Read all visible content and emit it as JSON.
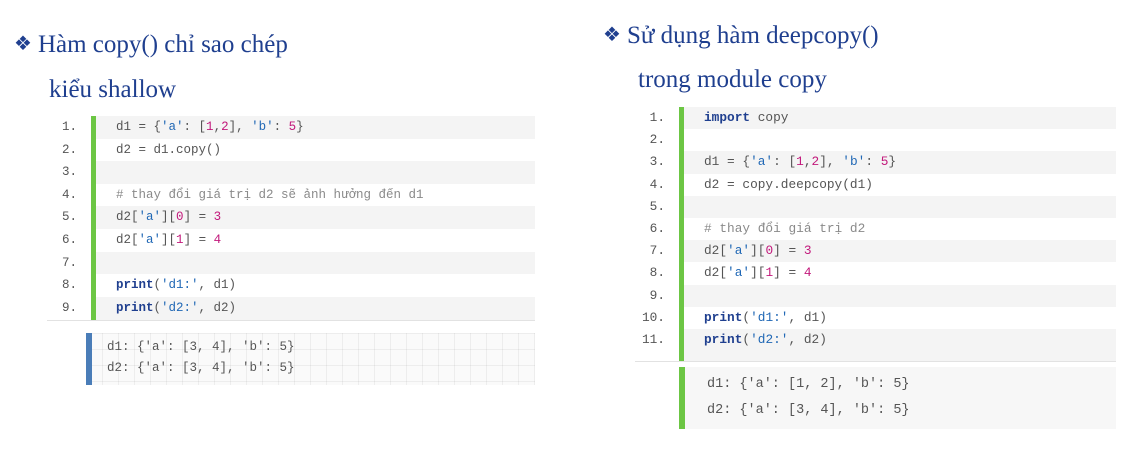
{
  "left": {
    "heading_line1": "Hàm copy() chỉ sao chép",
    "heading_line2": "kiểu shallow",
    "bullet": "❖",
    "code_lines": [
      {
        "n": "1.",
        "code": "d1 = {'a': [1,2], 'b': 5}"
      },
      {
        "n": "2.",
        "code": "d2 = d1.copy()"
      },
      {
        "n": "3.",
        "code": ""
      },
      {
        "n": "4.",
        "code": "# thay đổi giá trị d2 sẽ ảnh hưởng đến d1"
      },
      {
        "n": "5.",
        "code": "d2['a'][0] = 3"
      },
      {
        "n": "6.",
        "code": "d2['a'][1] = 4"
      },
      {
        "n": "7.",
        "code": ""
      },
      {
        "n": "8.",
        "code": "print('d1:', d1)"
      },
      {
        "n": "9.",
        "code": "print('d2:', d2)"
      }
    ],
    "output_lines": [
      "d1: {'a': [3, 4], 'b': 5}",
      "d2: {'a': [3, 4], 'b': 5}"
    ],
    "output_bar_color": "#4a7db8"
  },
  "right": {
    "heading_line1": "Sử dụng hàm deepcopy()",
    "heading_line2": "trong module copy",
    "bullet": "❖",
    "code_lines": [
      {
        "n": "1.",
        "code": "import copy"
      },
      {
        "n": "2.",
        "code": ""
      },
      {
        "n": "3.",
        "code": "d1 = {'a': [1,2], 'b': 5}"
      },
      {
        "n": "4.",
        "code": "d2 = copy.deepcopy(d1)"
      },
      {
        "n": "5.",
        "code": ""
      },
      {
        "n": "6.",
        "code": "# thay đổi giá trị d2"
      },
      {
        "n": "7.",
        "code": "d2['a'][0] = 3"
      },
      {
        "n": "8.",
        "code": "d2['a'][1] = 4"
      },
      {
        "n": "9.",
        "code": ""
      },
      {
        "n": "10.",
        "code": "print('d1:', d1)"
      },
      {
        "n": "11.",
        "code": "print('d2:', d2)"
      }
    ],
    "output_lines": [
      "d1: {'a': [1, 2], 'b': 5}",
      "d2: {'a': [3, 4], 'b': 5}"
    ],
    "output_bar_color": "#6cc644"
  },
  "colors": {
    "heading": "#1f3f8f",
    "gutter_bar": "#6cc644",
    "keyword": "#1f3f8f",
    "string": "#1f67b5",
    "number": "#c2187b",
    "comment": "#8a8a8a"
  }
}
